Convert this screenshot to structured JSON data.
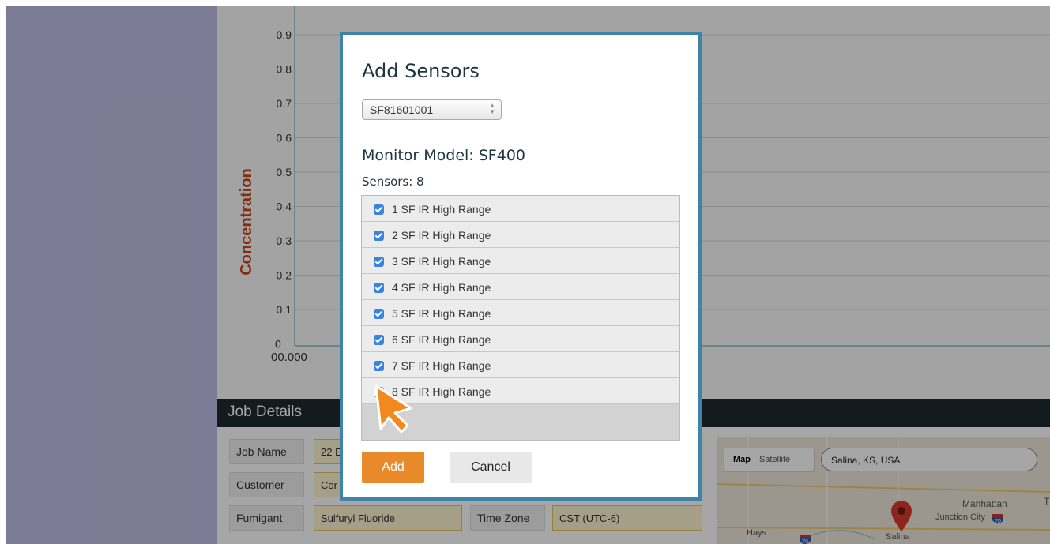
{
  "chart": {
    "ylabel": "Concentration",
    "ticks": [
      "0.9",
      "0.8",
      "0.7",
      "0.6",
      "0.5",
      "0.4",
      "0.3",
      "0.2",
      "0.1",
      "0"
    ],
    "x_first_tick": "00.000"
  },
  "job_details": {
    "header": "Job Details",
    "fields": [
      {
        "label": "Job Name",
        "value": "22 E"
      },
      {
        "label": "Customer",
        "value": "Cor"
      },
      {
        "label": "Fumigant",
        "value": "Sulfuryl Fluoride"
      }
    ],
    "time_zone": {
      "label": "Time Zone",
      "value": "CST (UTC-6)"
    }
  },
  "map": {
    "toggle_map": "Map",
    "toggle_satellite": "Satellite",
    "search_value": "Salina, KS, USA",
    "places": [
      "Manhattan",
      "Junction City",
      "Hays",
      "Salina",
      "T"
    ],
    "shields": [
      "70",
      "70"
    ]
  },
  "modal": {
    "title": "Add Sensors",
    "selected_device": "SF81601001",
    "model_text": "Monitor Model: SF400",
    "count_text": "Sensors: 8",
    "sensors": [
      {
        "label": "1 SF IR High Range",
        "checked": true
      },
      {
        "label": "2 SF IR High Range",
        "checked": true
      },
      {
        "label": "3 SF IR High Range",
        "checked": true
      },
      {
        "label": "4 SF IR High Range",
        "checked": true
      },
      {
        "label": "5 SF IR High Range",
        "checked": true
      },
      {
        "label": "6 SF IR High Range",
        "checked": true
      },
      {
        "label": "7 SF IR High Range",
        "checked": true
      },
      {
        "label": "8 SF IR High Range",
        "checked": false
      }
    ],
    "add_label": "Add",
    "cancel_label": "Cancel"
  },
  "colors": {
    "accent": "#e8892a",
    "modal_border": "#3d84a8",
    "checkbox": "#3b83e0",
    "ylabel": "#c8461c"
  }
}
